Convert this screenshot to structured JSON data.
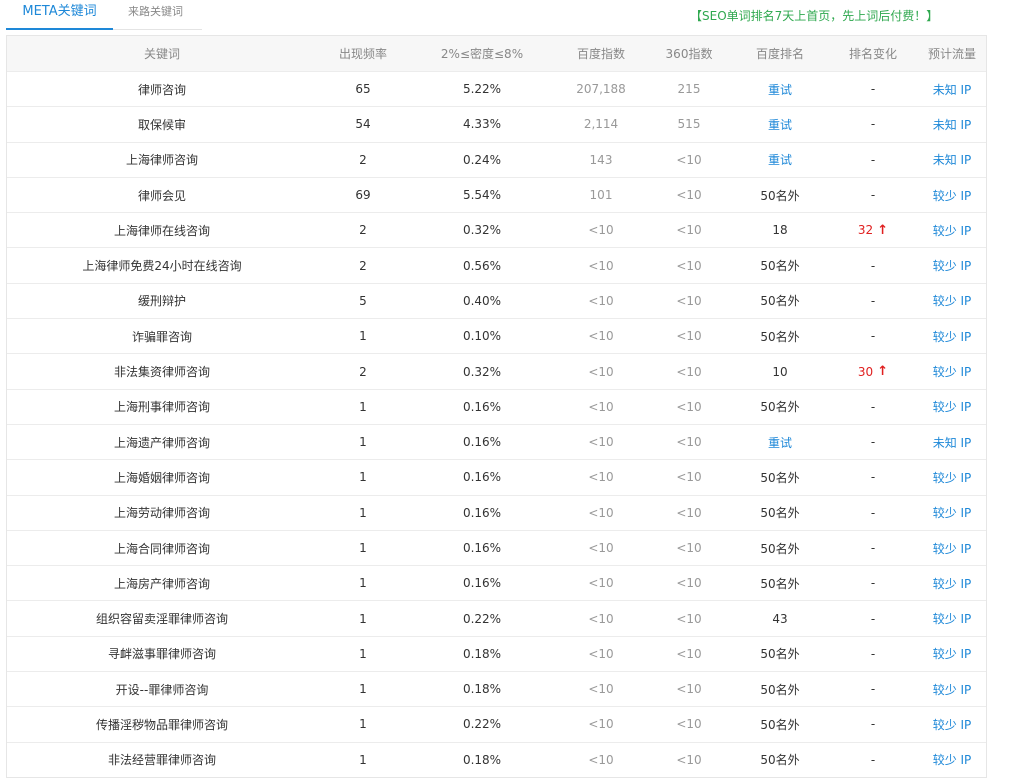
{
  "tabs": [
    {
      "label": "META关键词",
      "active": true
    },
    {
      "label": "来路关键词",
      "active": false
    }
  ],
  "promo_text": "【SEO单词排名7天上首页，先上词后付费！】",
  "colors": {
    "accent": "#1e88d8",
    "promo": "#2fa84f",
    "rise": "#e02020"
  },
  "table": {
    "columns": [
      "关键词",
      "出现频率",
      "2%≤密度≤8%",
      "百度指数",
      "360指数",
      "百度排名",
      "排名变化",
      "预计流量"
    ],
    "rows": [
      {
        "keyword": "律师咨询",
        "freq": "65",
        "density": "5.22%",
        "baidu_index": "207,188",
        "index360": "215",
        "baidu_rank": "重试",
        "change": "-",
        "traffic": "未知 IP"
      },
      {
        "keyword": "取保候审",
        "freq": "54",
        "density": "4.33%",
        "baidu_index": "2,114",
        "index360": "515",
        "baidu_rank": "重试",
        "change": "-",
        "traffic": "未知 IP"
      },
      {
        "keyword": "上海律师咨询",
        "freq": "2",
        "density": "0.24%",
        "baidu_index": "143",
        "index360": "<10",
        "baidu_rank": "重试",
        "change": "-",
        "traffic": "未知 IP"
      },
      {
        "keyword": "律师会见",
        "freq": "69",
        "density": "5.54%",
        "baidu_index": "101",
        "index360": "<10",
        "baidu_rank": "50名外",
        "change": "-",
        "traffic": "较少 IP"
      },
      {
        "keyword": "上海律师在线咨询",
        "freq": "2",
        "density": "0.32%",
        "baidu_index": "<10",
        "index360": "<10",
        "baidu_rank": "18",
        "change": "32",
        "traffic": "较少 IP"
      },
      {
        "keyword": "上海律师免费24小时在线咨询",
        "freq": "2",
        "density": "0.56%",
        "baidu_index": "<10",
        "index360": "<10",
        "baidu_rank": "50名外",
        "change": "-",
        "traffic": "较少 IP"
      },
      {
        "keyword": "缓刑辩护",
        "freq": "5",
        "density": "0.40%",
        "baidu_index": "<10",
        "index360": "<10",
        "baidu_rank": "50名外",
        "change": "-",
        "traffic": "较少 IP"
      },
      {
        "keyword": "诈骗罪咨询",
        "freq": "1",
        "density": "0.10%",
        "baidu_index": "<10",
        "index360": "<10",
        "baidu_rank": "50名外",
        "change": "-",
        "traffic": "较少 IP"
      },
      {
        "keyword": "非法集资律师咨询",
        "freq": "2",
        "density": "0.32%",
        "baidu_index": "<10",
        "index360": "<10",
        "baidu_rank": "10",
        "change": "30",
        "traffic": "较少 IP"
      },
      {
        "keyword": "上海刑事律师咨询",
        "freq": "1",
        "density": "0.16%",
        "baidu_index": "<10",
        "index360": "<10",
        "baidu_rank": "50名外",
        "change": "-",
        "traffic": "较少 IP"
      },
      {
        "keyword": "上海遗产律师咨询",
        "freq": "1",
        "density": "0.16%",
        "baidu_index": "<10",
        "index360": "<10",
        "baidu_rank": "重试",
        "change": "-",
        "traffic": "未知 IP"
      },
      {
        "keyword": "上海婚姻律师咨询",
        "freq": "1",
        "density": "0.16%",
        "baidu_index": "<10",
        "index360": "<10",
        "baidu_rank": "50名外",
        "change": "-",
        "traffic": "较少 IP"
      },
      {
        "keyword": "上海劳动律师咨询",
        "freq": "1",
        "density": "0.16%",
        "baidu_index": "<10",
        "index360": "<10",
        "baidu_rank": "50名外",
        "change": "-",
        "traffic": "较少 IP"
      },
      {
        "keyword": "上海合同律师咨询",
        "freq": "1",
        "density": "0.16%",
        "baidu_index": "<10",
        "index360": "<10",
        "baidu_rank": "50名外",
        "change": "-",
        "traffic": "较少 IP"
      },
      {
        "keyword": "上海房产律师咨询",
        "freq": "1",
        "density": "0.16%",
        "baidu_index": "<10",
        "index360": "<10",
        "baidu_rank": "50名外",
        "change": "-",
        "traffic": "较少 IP"
      },
      {
        "keyword": "组织容留卖淫罪律师咨询",
        "freq": "1",
        "density": "0.22%",
        "baidu_index": "<10",
        "index360": "<10",
        "baidu_rank": "43",
        "change": "-",
        "traffic": "较少 IP"
      },
      {
        "keyword": "寻衅滋事罪律师咨询",
        "freq": "1",
        "density": "0.18%",
        "baidu_index": "<10",
        "index360": "<10",
        "baidu_rank": "50名外",
        "change": "-",
        "traffic": "较少 IP"
      },
      {
        "keyword": "开设--罪律师咨询",
        "freq": "1",
        "density": "0.18%",
        "baidu_index": "<10",
        "index360": "<10",
        "baidu_rank": "50名外",
        "change": "-",
        "traffic": "较少 IP"
      },
      {
        "keyword": "传播淫秽物品罪律师咨询",
        "freq": "1",
        "density": "0.22%",
        "baidu_index": "<10",
        "index360": "<10",
        "baidu_rank": "50名外",
        "change": "-",
        "traffic": "较少 IP"
      },
      {
        "keyword": "非法经营罪律师咨询",
        "freq": "1",
        "density": "0.18%",
        "baidu_index": "<10",
        "index360": "<10",
        "baidu_rank": "50名外",
        "change": "-",
        "traffic": "较少 IP"
      }
    ]
  }
}
